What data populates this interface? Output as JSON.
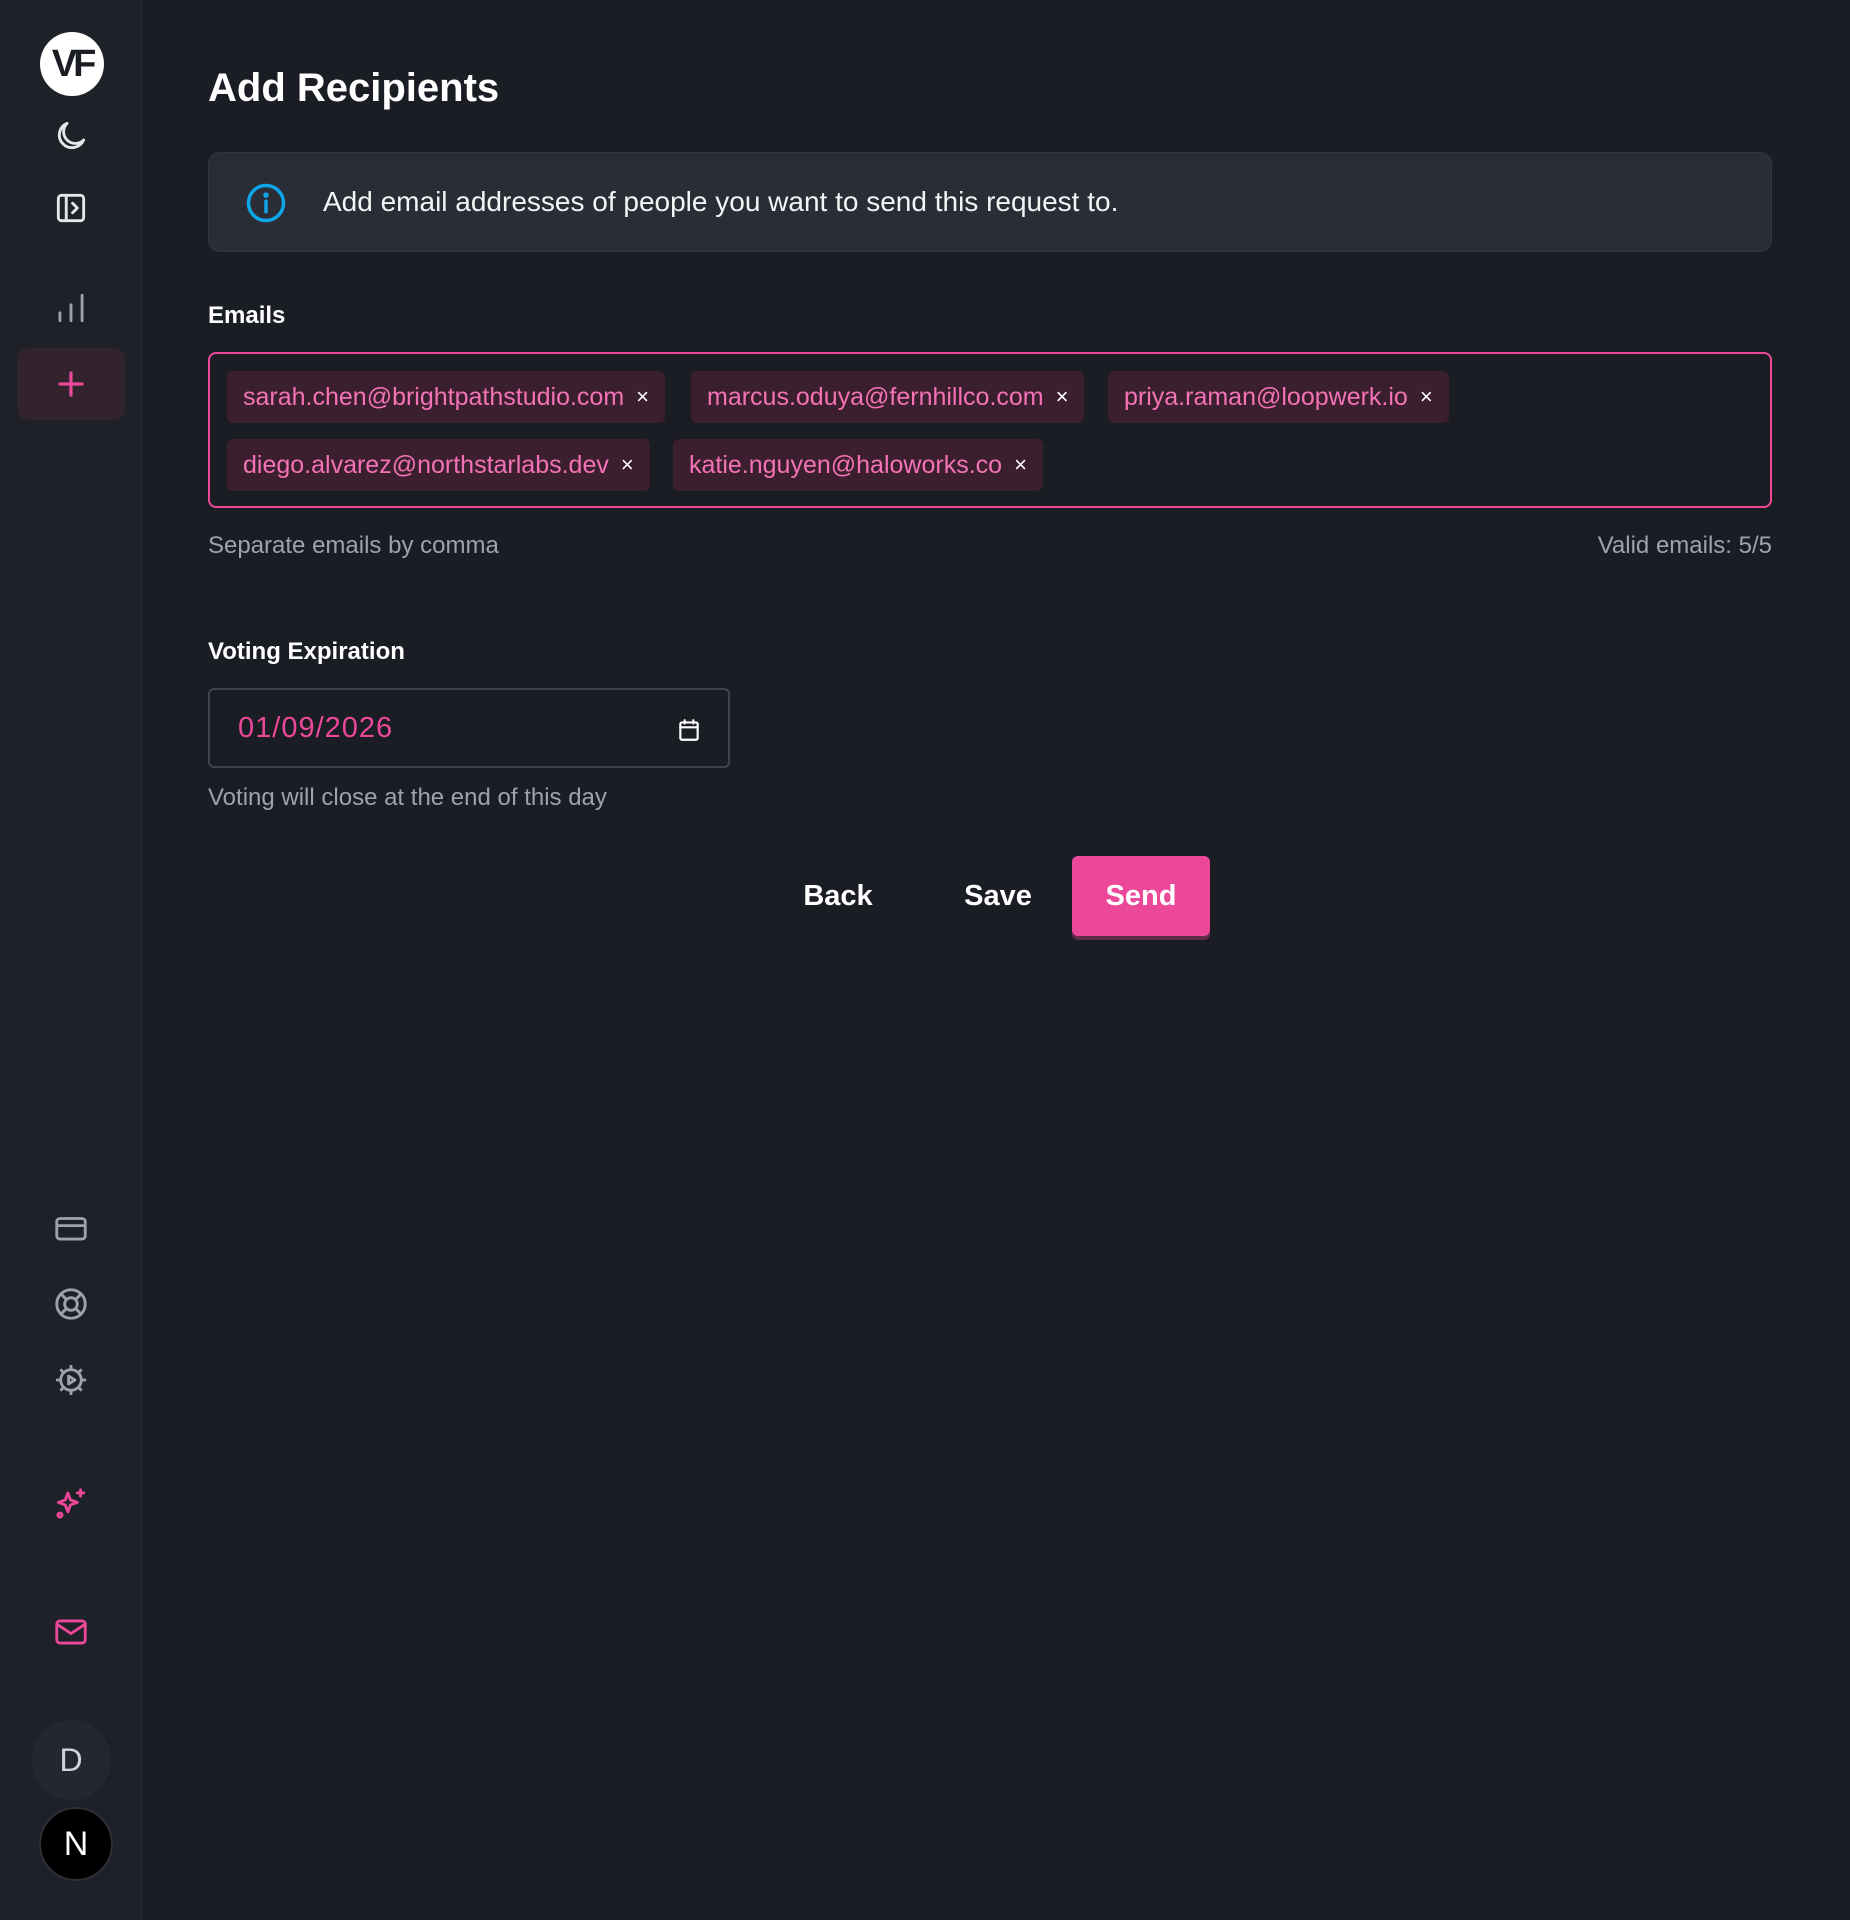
{
  "sidebar": {
    "logo_text": "VF",
    "icons": [
      "moon-icon",
      "sidebar-toggle-icon",
      "bar-chart-icon",
      "plus-icon",
      "credit-card-icon",
      "lifebuoy-icon",
      "settings-icon",
      "sparkles-icon",
      "mail-icon"
    ],
    "user_initial": "D",
    "workspace_initial": "N"
  },
  "page": {
    "title": "Add Recipients",
    "info_text": "Add email addresses of people you want to send this request to."
  },
  "emails": {
    "label": "Emails",
    "chips": [
      "sarah.chen@brightpathstudio.com",
      "marcus.oduya@fernhillco.com",
      "priya.raman@loopwerk.io",
      "diego.alvarez@northstarlabs.dev",
      "katie.nguyen@haloworks.co"
    ],
    "remove_glyph": "×",
    "hint": "Separate emails by comma",
    "valid_count": "Valid emails: 5/5"
  },
  "expiration": {
    "label": "Voting Expiration",
    "value": "01/09/2026",
    "hint": "Voting will close at the end of this day"
  },
  "actions": {
    "back": "Back",
    "save": "Save",
    "send": "Send"
  },
  "colors": {
    "accent": "#ec4899",
    "background": "#1a1d23",
    "info_icon": "#0ea5e9"
  }
}
